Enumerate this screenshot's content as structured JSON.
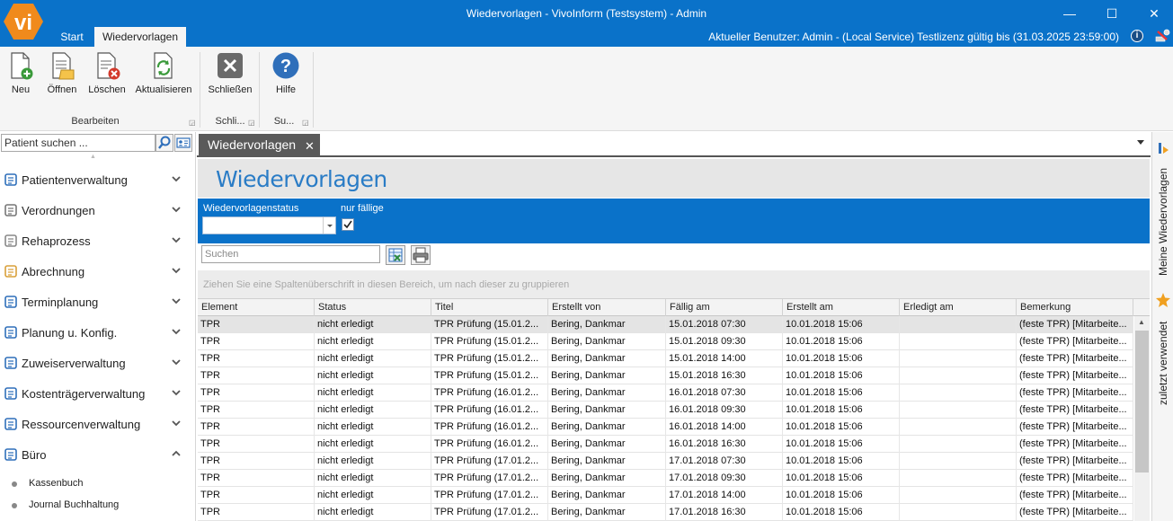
{
  "window": {
    "title": "Wiedervorlagen - VivoInform (Testsystem) - Admin",
    "logo_text": "vi",
    "status": "Aktueller Benutzer: Admin - (Local Service) Testlizenz gültig bis (31.03.2025 23:59:00)",
    "info_label": "i",
    "minimize": "—",
    "maximize": "☐",
    "close": "✕"
  },
  "tabs": {
    "start": "Start",
    "active": "Wiedervorlagen"
  },
  "ribbon": {
    "buttons": {
      "new": "Neu",
      "open": "Öffnen",
      "delete": "Löschen",
      "refresh": "Aktualisieren",
      "close": "Schließen",
      "help": "Hilfe"
    },
    "groups": {
      "edit": "Bearbeiten",
      "close": "Schli...",
      "support": "Su..."
    }
  },
  "leftnav": {
    "search_placeholder": "Patient suchen ...",
    "items": [
      {
        "label": "Patientenverwaltung",
        "icon": "patient-icon",
        "expanded": false
      },
      {
        "label": "Verordnungen",
        "icon": "prescription-icon",
        "expanded": false
      },
      {
        "label": "Rehaprozess",
        "icon": "rehab-icon",
        "expanded": false
      },
      {
        "label": "Abrechnung",
        "icon": "billing-icon",
        "expanded": false
      },
      {
        "label": "Terminplanung",
        "icon": "calendar-icon",
        "expanded": false
      },
      {
        "label": "Planung u. Konfig.",
        "icon": "config-icon",
        "expanded": false
      },
      {
        "label": "Zuweiserverwaltung",
        "icon": "referrer-icon",
        "expanded": false
      },
      {
        "label": "Kostenträgerverwaltung",
        "icon": "insurer-icon",
        "expanded": false
      },
      {
        "label": "Ressourcenverwaltung",
        "icon": "resource-icon",
        "expanded": false
      },
      {
        "label": "Büro",
        "icon": "office-icon",
        "expanded": true
      }
    ],
    "sub_items": [
      "Kassenbuch",
      "Journal Buchhaltung"
    ]
  },
  "document": {
    "tab_label": "Wiedervorlagen",
    "tab_close": "✕",
    "page_title": "Wiedervorlagen",
    "filter": {
      "status_label": "Wiedervorlagenstatus",
      "status_value": "",
      "due_label": "nur fällige",
      "due_checked": true
    },
    "search_placeholder": "Suchen",
    "group_hint": "Ziehen Sie eine Spaltenüberschrift in diesen Bereich, um nach dieser zu gruppieren"
  },
  "grid": {
    "columns": [
      "Element",
      "Status",
      "Titel",
      "Erstellt von",
      "Fällig am",
      "Erstellt am",
      "Erledigt am",
      "Bemerkung"
    ],
    "rows": [
      [
        "TPR",
        "nicht erledigt",
        "TPR Prüfung (15.01.2...",
        "Bering, Dankmar",
        "15.01.2018 07:30",
        "10.01.2018 15:06",
        "",
        "(feste TPR) [Mitarbeite..."
      ],
      [
        "TPR",
        "nicht erledigt",
        "TPR Prüfung (15.01.2...",
        "Bering, Dankmar",
        "15.01.2018 09:30",
        "10.01.2018 15:06",
        "",
        "(feste TPR) [Mitarbeite..."
      ],
      [
        "TPR",
        "nicht erledigt",
        "TPR Prüfung (15.01.2...",
        "Bering, Dankmar",
        "15.01.2018 14:00",
        "10.01.2018 15:06",
        "",
        "(feste TPR) [Mitarbeite..."
      ],
      [
        "TPR",
        "nicht erledigt",
        "TPR Prüfung (15.01.2...",
        "Bering, Dankmar",
        "15.01.2018 16:30",
        "10.01.2018 15:06",
        "",
        "(feste TPR) [Mitarbeite..."
      ],
      [
        "TPR",
        "nicht erledigt",
        "TPR Prüfung (16.01.2...",
        "Bering, Dankmar",
        "16.01.2018 07:30",
        "10.01.2018 15:06",
        "",
        "(feste TPR) [Mitarbeite..."
      ],
      [
        "TPR",
        "nicht erledigt",
        "TPR Prüfung (16.01.2...",
        "Bering, Dankmar",
        "16.01.2018 09:30",
        "10.01.2018 15:06",
        "",
        "(feste TPR) [Mitarbeite..."
      ],
      [
        "TPR",
        "nicht erledigt",
        "TPR Prüfung (16.01.2...",
        "Bering, Dankmar",
        "16.01.2018 14:00",
        "10.01.2018 15:06",
        "",
        "(feste TPR) [Mitarbeite..."
      ],
      [
        "TPR",
        "nicht erledigt",
        "TPR Prüfung (16.01.2...",
        "Bering, Dankmar",
        "16.01.2018 16:30",
        "10.01.2018 15:06",
        "",
        "(feste TPR) [Mitarbeite..."
      ],
      [
        "TPR",
        "nicht erledigt",
        "TPR Prüfung (17.01.2...",
        "Bering, Dankmar",
        "17.01.2018 07:30",
        "10.01.2018 15:06",
        "",
        "(feste TPR) [Mitarbeite..."
      ],
      [
        "TPR",
        "nicht erledigt",
        "TPR Prüfung (17.01.2...",
        "Bering, Dankmar",
        "17.01.2018 09:30",
        "10.01.2018 15:06",
        "",
        "(feste TPR) [Mitarbeite..."
      ],
      [
        "TPR",
        "nicht erledigt",
        "TPR Prüfung (17.01.2...",
        "Bering, Dankmar",
        "17.01.2018 14:00",
        "10.01.2018 15:06",
        "",
        "(feste TPR) [Mitarbeite..."
      ],
      [
        "TPR",
        "nicht erledigt",
        "TPR Prüfung (17.01.2...",
        "Bering, Dankmar",
        "17.01.2018 16:30",
        "10.01.2018 15:06",
        "",
        "(feste TPR) [Mitarbeite..."
      ]
    ],
    "selected_row": 0
  },
  "rightpanel": {
    "items": [
      "Meine Wiedervorlagen",
      "zuletzt verwendet"
    ]
  },
  "colors": {
    "accent": "#0a72c9",
    "title_blue": "#2a7cc6",
    "logo_orange": "#f08a1c"
  }
}
